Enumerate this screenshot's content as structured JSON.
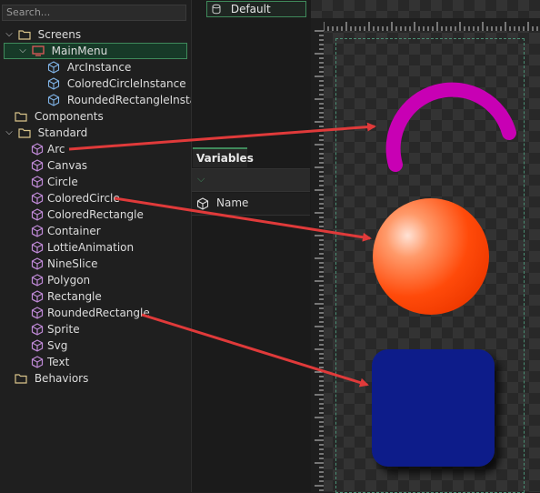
{
  "tree": {
    "search_placeholder": "Search...",
    "items": [
      {
        "label": "Screens",
        "icon": "folder-icon",
        "expanded": true
      },
      {
        "label": "MainMenu",
        "icon": "screen-icon",
        "expanded": true
      },
      {
        "label": "ArcInstance",
        "icon": "instance-icon"
      },
      {
        "label": "ColoredCircleInstance",
        "icon": "instance-icon"
      },
      {
        "label": "RoundedRectangleInstance",
        "icon": "instance-icon"
      },
      {
        "label": "Components",
        "icon": "folder-icon"
      },
      {
        "label": "Standard",
        "icon": "folder-icon",
        "expanded": true
      },
      {
        "label": "Arc",
        "icon": "standard-element-icon"
      },
      {
        "label": "Canvas",
        "icon": "standard-element-icon"
      },
      {
        "label": "Circle",
        "icon": "standard-element-icon"
      },
      {
        "label": "ColoredCircle",
        "icon": "standard-element-icon"
      },
      {
        "label": "ColoredRectangle",
        "icon": "standard-element-icon"
      },
      {
        "label": "Container",
        "icon": "standard-element-icon"
      },
      {
        "label": "LottieAnimation",
        "icon": "standard-element-icon"
      },
      {
        "label": "NineSlice",
        "icon": "standard-element-icon"
      },
      {
        "label": "Polygon",
        "icon": "standard-element-icon"
      },
      {
        "label": "Rectangle",
        "icon": "standard-element-icon"
      },
      {
        "label": "RoundedRectangle",
        "icon": "standard-element-icon"
      },
      {
        "label": "Sprite",
        "icon": "standard-element-icon"
      },
      {
        "label": "Svg",
        "icon": "standard-element-icon"
      },
      {
        "label": "Text",
        "icon": "standard-element-icon"
      },
      {
        "label": "Behaviors",
        "icon": "folder-icon"
      }
    ]
  },
  "states": {
    "default_label": "Default"
  },
  "variables": {
    "tab_label": "Variables",
    "name_column": "Name"
  },
  "colors": {
    "arc": "#c800b4",
    "circle_light": "#ffd2c0",
    "circle_dark": "#ff4000",
    "rounded_rect": "#0f1e8a",
    "arrow": "#e03a3a",
    "selection": "#3f8a5b"
  }
}
